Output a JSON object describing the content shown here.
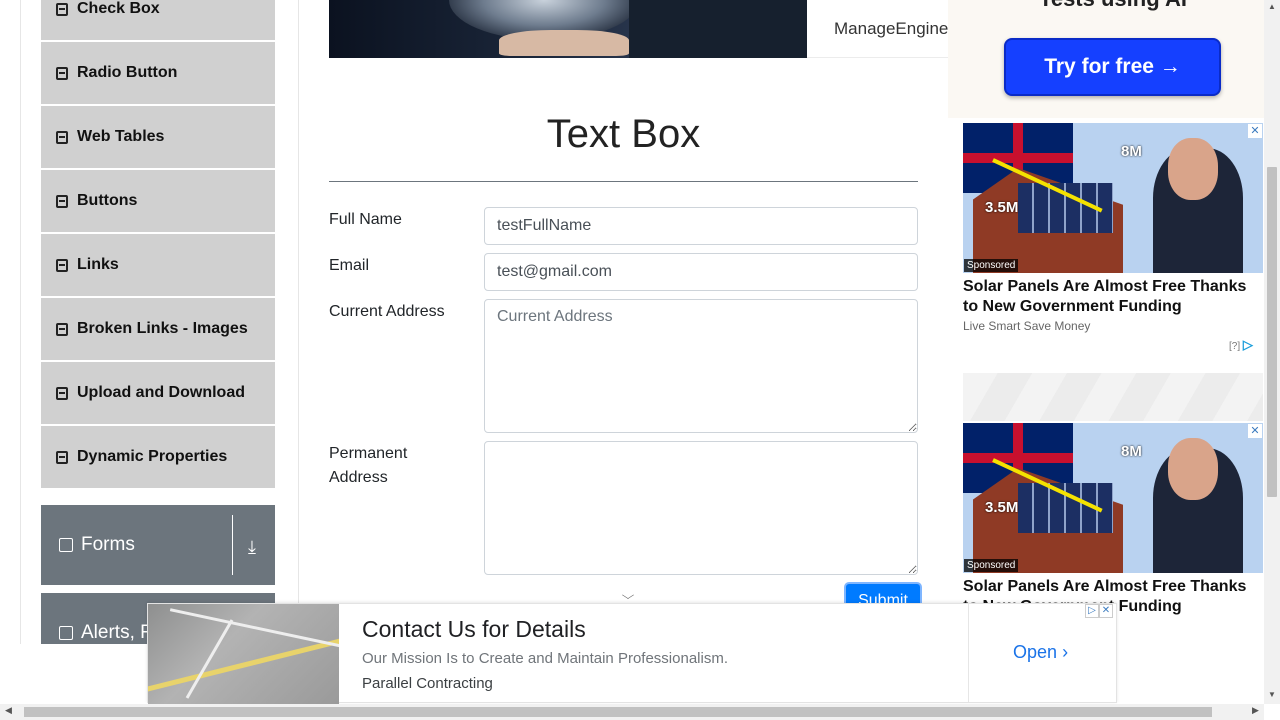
{
  "sidebar": {
    "items": [
      {
        "label": "Check Box"
      },
      {
        "label": "Radio Button"
      },
      {
        "label": "Web Tables"
      },
      {
        "label": "Buttons"
      },
      {
        "label": "Links"
      },
      {
        "label": "Broken Links - Images"
      },
      {
        "label": "Upload and Download"
      },
      {
        "label": "Dynamic Properties"
      }
    ],
    "groups": [
      {
        "label": "Forms"
      },
      {
        "label": "Alerts, F"
      }
    ]
  },
  "banner": {
    "brand": "ManageEngine"
  },
  "main": {
    "title": "Text Box",
    "fields": {
      "full_name_label": "Full Name",
      "full_name_value": "testFullName",
      "email_label": "Email",
      "email_value": "test@gmail.com",
      "current_address_label": "Current Address",
      "current_address_placeholder": "Current Address",
      "permanent_address_label": "Permanent Address"
    },
    "submit_label": "Submit"
  },
  "right_ads": {
    "top_cut_text": "Tests using AI",
    "try_button": "Try for free →",
    "cards": [
      {
        "headline": "Solar Panels Are Almost Free Thanks to New Government Funding",
        "source": "Live Smart Save Money",
        "badge": "Sponsored",
        "label_a": "8M",
        "label_b": "3.5M"
      },
      {
        "headline": "Solar Panels Are Almost Free Thanks to New Government Funding",
        "badge": "Sponsored",
        "label_a": "8M",
        "label_b": "3.5M"
      }
    ],
    "adchoice": "[?]"
  },
  "bottom_ad": {
    "title": "Contact Us for Details",
    "subtitle": "Our Mission Is to Create and Maintain Professionalism.",
    "advertiser": "Parallel Contracting",
    "cta": "Open"
  },
  "colors": {
    "primary": "#007bff",
    "sidebar_item": "#d0d0d0",
    "group_header": "#6c757d",
    "try_button": "#1540ff",
    "ad_link": "#1a73e8"
  }
}
